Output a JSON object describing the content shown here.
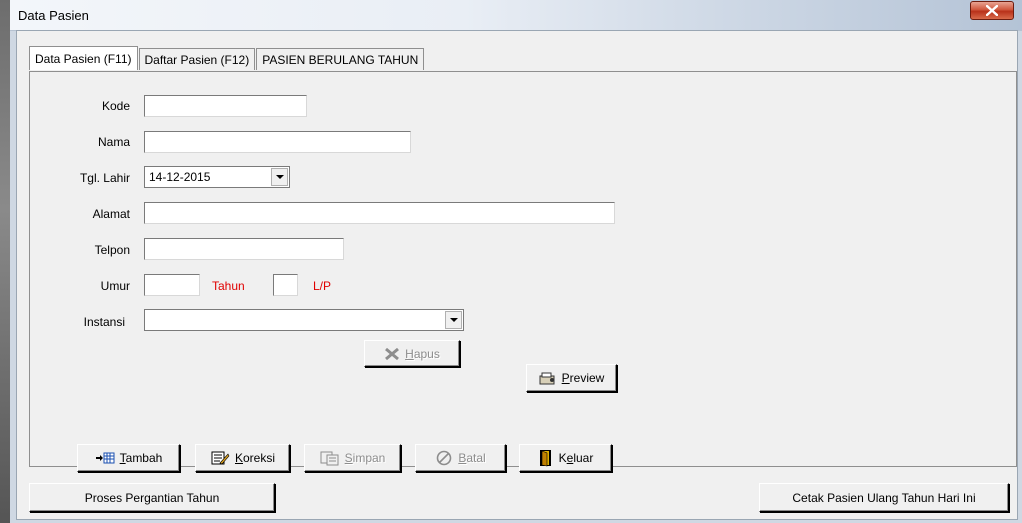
{
  "window": {
    "title": "Data Pasien"
  },
  "tabs": [
    {
      "label": "Data Pasien (F11)",
      "active": true
    },
    {
      "label": "Daftar Pasien (F12)",
      "active": false
    },
    {
      "label": "PASIEN BERULANG TAHUN",
      "active": false
    }
  ],
  "form": {
    "kode": {
      "label": "Kode",
      "value": ""
    },
    "nama": {
      "label": "Nama",
      "value": ""
    },
    "tgl_lahir": {
      "label": "Tgl. Lahir",
      "value": "14-12-2015"
    },
    "alamat": {
      "label": "Alamat",
      "value": ""
    },
    "telpon": {
      "label": "Telpon",
      "value": ""
    },
    "umur": {
      "label": "Umur",
      "value": "",
      "unit": "Tahun"
    },
    "jk": {
      "value": "",
      "label": "L/P"
    },
    "instansi": {
      "label": "Instansi",
      "value": ""
    }
  },
  "buttons": {
    "hapus": {
      "mnemonic": "H",
      "rest": "apus",
      "enabled": false,
      "icon": "delete-x-icon"
    },
    "preview": {
      "mnemonic": "P",
      "rest": "review",
      "enabled": true,
      "icon": "preview-icon"
    },
    "tambah": {
      "mnemonic": "T",
      "rest": "ambah",
      "enabled": true,
      "icon": "add-record-icon"
    },
    "koreksi": {
      "mnemonic": "K",
      "rest": "oreksi",
      "enabled": true,
      "icon": "edit-record-icon"
    },
    "simpan": {
      "mnemonic": "S",
      "rest": "impan",
      "enabled": false,
      "icon": "save-icon"
    },
    "batal": {
      "mnemonic": "B",
      "rest": "atal",
      "enabled": false,
      "icon": "cancel-icon"
    },
    "keluar": {
      "prefix": "K",
      "mnemonic": "e",
      "rest": "luar",
      "enabled": true,
      "icon": "exit-door-icon"
    }
  },
  "footer": {
    "proses_label": "Proses Pergantian Tahun",
    "cetak_label": "Cetak Pasien Ulang Tahun Hari Ini"
  },
  "colors": {
    "accent_red": "#e00000",
    "close_button": "#c7442a"
  }
}
